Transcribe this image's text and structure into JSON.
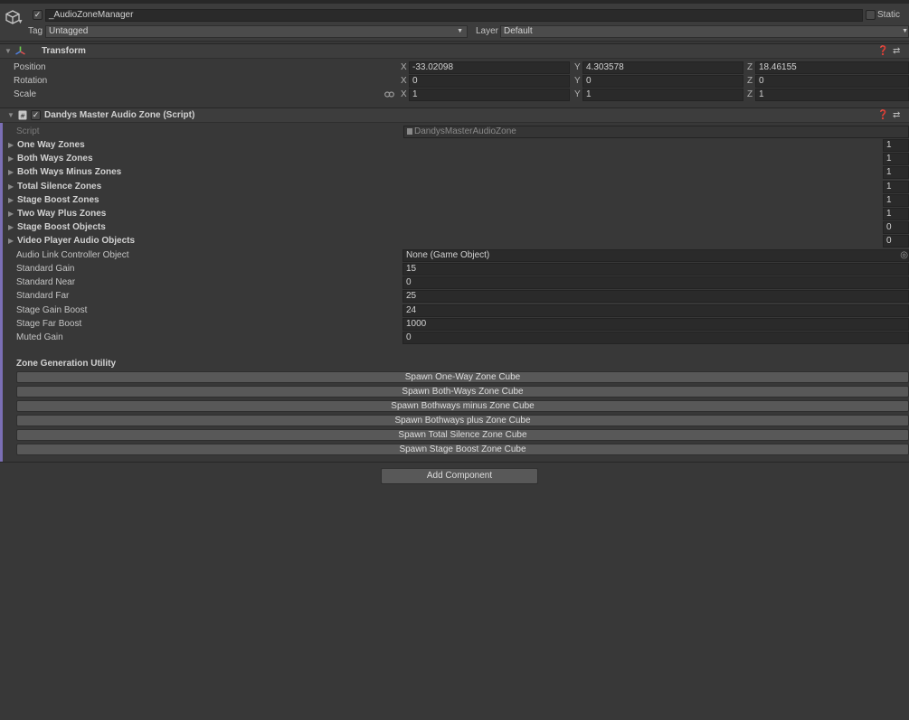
{
  "object": {
    "enabled_mark": "✓",
    "name": "_AudioZoneManager",
    "static_label": "Static",
    "tag_label": "Tag",
    "tag_value": "Untagged",
    "layer_label": "Layer",
    "layer_value": "Default"
  },
  "transform": {
    "title": "Transform",
    "position_label": "Position",
    "rotation_label": "Rotation",
    "scale_label": "Scale",
    "axis_x": "X",
    "axis_y": "Y",
    "axis_z": "Z",
    "position": {
      "x": "-33.02098",
      "y": "4.303578",
      "z": "18.46155"
    },
    "rotation": {
      "x": "0",
      "y": "0",
      "z": "0"
    },
    "scale": {
      "x": "1",
      "y": "1",
      "z": "1"
    }
  },
  "component": {
    "enabled_mark": "✓",
    "title": "Dandys Master Audio Zone (Script)",
    "script_label": "Script",
    "script_value": "DandysMasterAudioZone",
    "arrays": [
      {
        "label": "One Way Zones",
        "count": "1"
      },
      {
        "label": "Both Ways Zones",
        "count": "1"
      },
      {
        "label": "Both Ways Minus Zones",
        "count": "1"
      },
      {
        "label": "Total Silence Zones",
        "count": "1"
      },
      {
        "label": "Stage Boost Zones",
        "count": "1"
      },
      {
        "label": "Two Way Plus Zones",
        "count": "1"
      },
      {
        "label": "Stage Boost Objects",
        "count": "0"
      },
      {
        "label": "Video Player Audio Objects",
        "count": "0"
      }
    ],
    "fields": [
      {
        "label": "Audio Link Controller Object",
        "value": "None (Game Object)"
      },
      {
        "label": "Standard Gain",
        "value": "15"
      },
      {
        "label": "Standard Near",
        "value": "0"
      },
      {
        "label": "Standard Far",
        "value": "25"
      },
      {
        "label": "Stage Gain Boost",
        "value": "24"
      },
      {
        "label": "Stage Far Boost",
        "value": "1000"
      },
      {
        "label": "Muted Gain",
        "value": "0"
      }
    ],
    "utility_title": "Zone Generation Utility",
    "buttons": [
      "Spawn One-Way Zone Cube",
      "Spawn Both-Ways Zone Cube",
      "Spawn Bothways minus Zone Cube",
      "Spawn Bothways plus Zone Cube",
      "Spawn Total Silence Zone Cube",
      "Spawn Stage Boost Zone Cube"
    ]
  },
  "add_component_label": "Add Component",
  "colors": {
    "background": "#383838",
    "field": "#2a2a2a",
    "button": "#585858",
    "accent_bar": "#7b6fb5"
  }
}
